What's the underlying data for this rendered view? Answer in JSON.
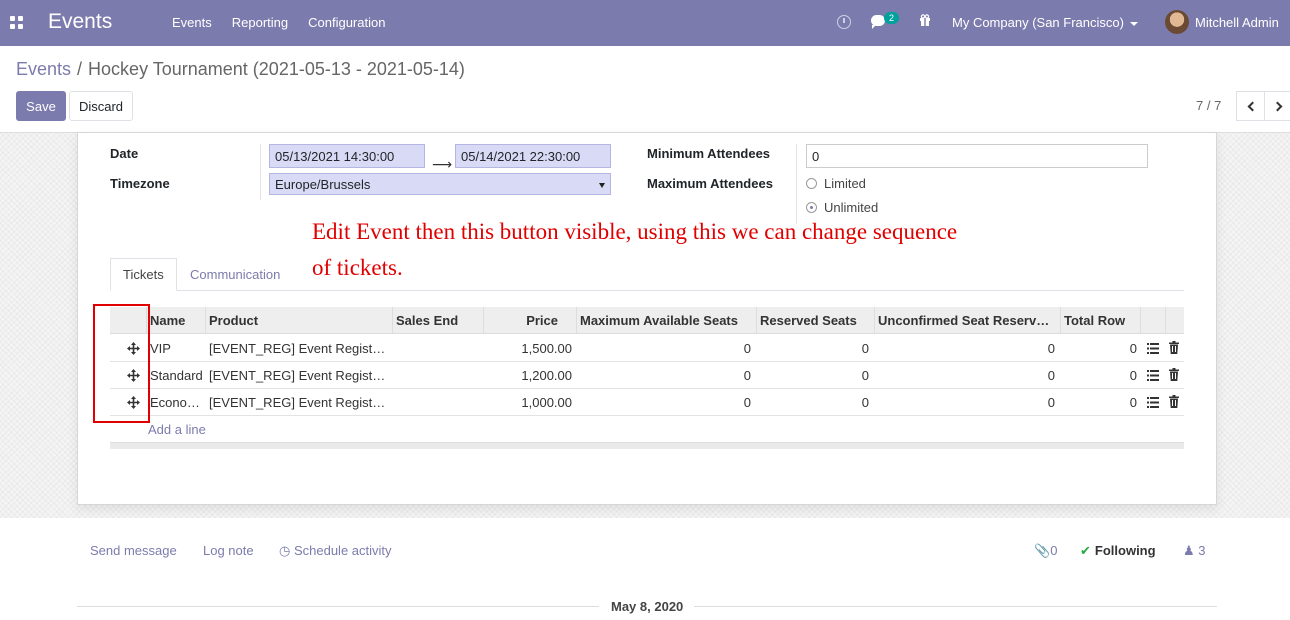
{
  "navbar": {
    "app_title": "Events",
    "menu": [
      "Events",
      "Reporting",
      "Configuration"
    ],
    "chat_badge": "2",
    "company": "My Company (San Francisco)",
    "user": "Mitchell Admin",
    "color": "#7c7bad"
  },
  "breadcrumb": {
    "parent": "Events",
    "separator": "/",
    "current": "Hockey Tournament (2021-05-13 - 2021-05-14)"
  },
  "buttons": {
    "save": "Save",
    "discard": "Discard"
  },
  "pager": {
    "value": "7 / 7"
  },
  "form": {
    "date_label": "Date",
    "date_begin": "05/13/2021 14:30:00",
    "date_end": "05/14/2021 22:30:00",
    "timezone_label": "Timezone",
    "timezone": "Europe/Brussels",
    "min_attendees_label": "Minimum Attendees",
    "min_attendees": "0",
    "max_attendees_label": "Maximum Attendees",
    "seats_options": [
      "Limited",
      "Unlimited"
    ],
    "seats_selected": "Unlimited"
  },
  "annotation": {
    "line1": "Edit Event then this button visible, using this we can change sequence",
    "line2": "of tickets.",
    "color": "#e00000"
  },
  "tabs": [
    "Tickets",
    "Communication"
  ],
  "tickets": {
    "columns": [
      "Name",
      "Product",
      "Sales End",
      "Price",
      "Maximum Available Seats",
      "Reserved Seats",
      "Unconfirmed Seat Reserv…",
      "Total Row"
    ],
    "rows": [
      {
        "name": "VIP",
        "product": "[EVENT_REG] Event Regist…",
        "sales_end": "",
        "price": "1,500.00",
        "max_seats": "0",
        "reserved": "0",
        "unconfirmed": "0",
        "total": "0"
      },
      {
        "name": "Standard",
        "product": "[EVENT_REG] Event Regist…",
        "sales_end": "",
        "price": "1,200.00",
        "max_seats": "0",
        "reserved": "0",
        "unconfirmed": "0",
        "total": "0"
      },
      {
        "name": "Economy",
        "product": "[EVENT_REG] Event Regist…",
        "sales_end": "",
        "price": "1,000.00",
        "max_seats": "0",
        "reserved": "0",
        "unconfirmed": "0",
        "total": "0"
      }
    ],
    "add_line": "Add a line"
  },
  "chatter": {
    "send_message": "Send message",
    "log_note": "Log note",
    "schedule_activity": "Schedule activity",
    "attachments": "0",
    "following": "Following",
    "followers": "3",
    "date_separator": "May 8, 2020"
  }
}
